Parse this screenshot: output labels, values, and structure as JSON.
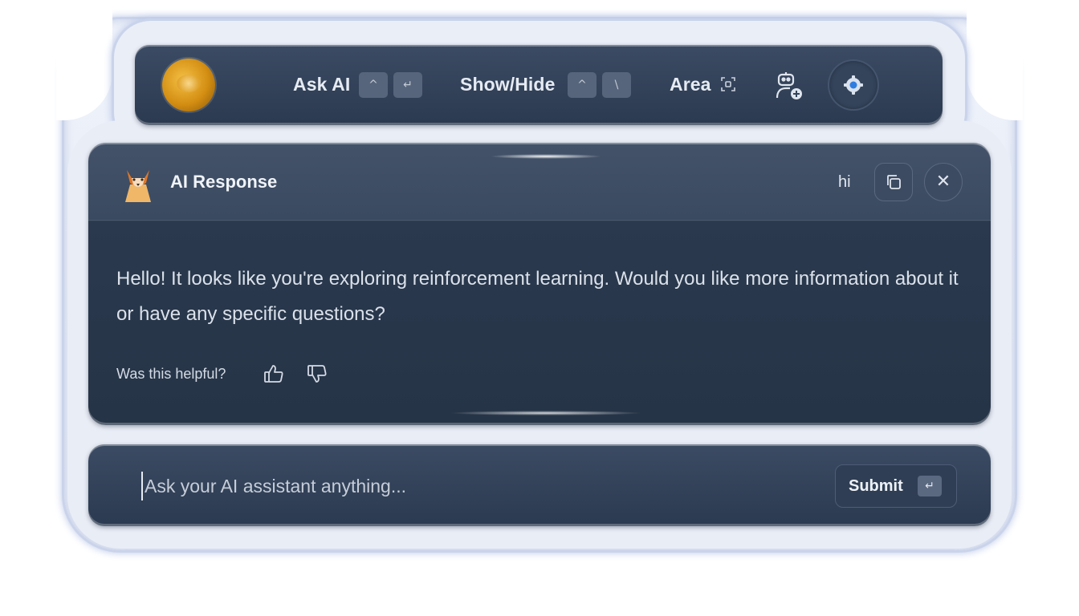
{
  "toolbar": {
    "ask_ai_label": "Ask AI",
    "ask_ai_keys": [
      "^",
      "↵"
    ],
    "show_hide_label": "Show/Hide",
    "show_hide_keys": [
      "^",
      "\\"
    ],
    "area_label": "Area",
    "icons": [
      "avatar",
      "area-capture-icon",
      "bot-add-icon",
      "gear-icon"
    ]
  },
  "response": {
    "title": "AI Response",
    "query": "hi",
    "message": "Hello! It looks like you're exploring reinforcement learning. Would you like more information about it or have any specific questions?",
    "helpful_label": "Was this helpful?",
    "close_glyph": "✕",
    "icons": [
      "fox-icon",
      "copy-icon",
      "close-icon",
      "thumbs-up-icon",
      "thumbs-down-icon"
    ]
  },
  "input": {
    "placeholder": "Ask your AI assistant anything...",
    "value": "",
    "submit_label": "Submit",
    "submit_key": "↵"
  },
  "colors": {
    "panel": "#2b3a50",
    "frame": "#e7ecf6",
    "text": "#dbe1ea"
  }
}
